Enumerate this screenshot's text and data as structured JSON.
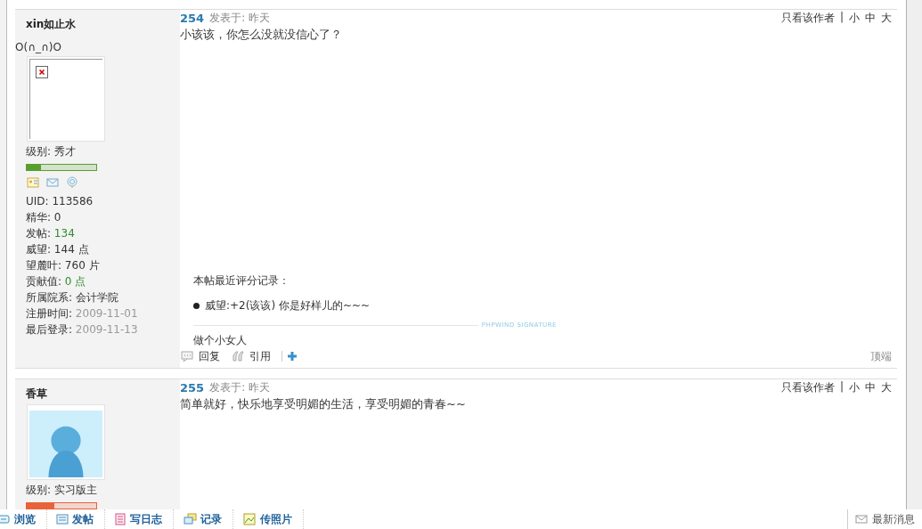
{
  "posts": [
    {
      "floor": "254",
      "posted": "发表于: 昨天",
      "only_author": "只看该作者",
      "separator": "|",
      "font_sizes": [
        "小",
        "中",
        "大"
      ],
      "user": {
        "name": "xin如止水",
        "mood": "O(∩_∩)O",
        "avatar": {
          "kind": "broken"
        },
        "rank": "级别: 秀才",
        "level": 0.2,
        "color": "#5a9e2f",
        "stats": [
          {
            "label": "UID: ",
            "value": "113586"
          },
          {
            "label": "精华: ",
            "value": "0"
          },
          {
            "label": "发帖: ",
            "value": "134",
            "color": "#2e8b2e"
          },
          {
            "label": "威望: ",
            "value": "144 点"
          },
          {
            "label": "望麓叶: ",
            "value": "760 片"
          },
          {
            "label": "贡献值: ",
            "value": "0 点",
            "color": "#2e8b2e"
          },
          {
            "label": "所属院系: ",
            "value": "会计学院"
          },
          {
            "label": "注册时间: ",
            "value": "2009-11-01",
            "color": "#999999"
          },
          {
            "label": "最后登录: ",
            "value": "2009-11-13",
            "color": "#999999"
          }
        ]
      },
      "body": "小该该，你怎么没就没信心了？",
      "rating": {
        "title": "本帖最近评分记录：",
        "entries": [
          "威望:+2(该该) 你是好样儿的~~~"
        ]
      },
      "signature_mark": "PHPWIND SIGNATURE",
      "signature": "做个小女人",
      "actions": [
        {
          "kind": "reply",
          "label": "回复"
        },
        {
          "kind": "quote",
          "label": "引用"
        },
        {
          "kind": "more"
        }
      ],
      "top_link": "顶端"
    },
    {
      "floor": "255",
      "posted": "发表于: 昨天",
      "only_author": "只看该作者",
      "separator": "|",
      "font_sizes": [
        "小",
        "中",
        "大"
      ],
      "user": {
        "name": "香草",
        "avatar": {
          "kind": "default"
        },
        "rank": "级别: 实习版主",
        "level": 0.4,
        "color": "#e8623a"
      },
      "body": "简单就好，快乐地享受明媚的生活，享受明媚的青春~~"
    }
  ],
  "toolbar": {
    "items": [
      {
        "kind": "browse",
        "label": "浏览"
      },
      {
        "kind": "post",
        "label": "发帖"
      },
      {
        "kind": "diary",
        "label": "写日志"
      },
      {
        "kind": "record",
        "label": "记录"
      },
      {
        "label": "传照片"
      }
    ],
    "messages": "最新消息"
  }
}
